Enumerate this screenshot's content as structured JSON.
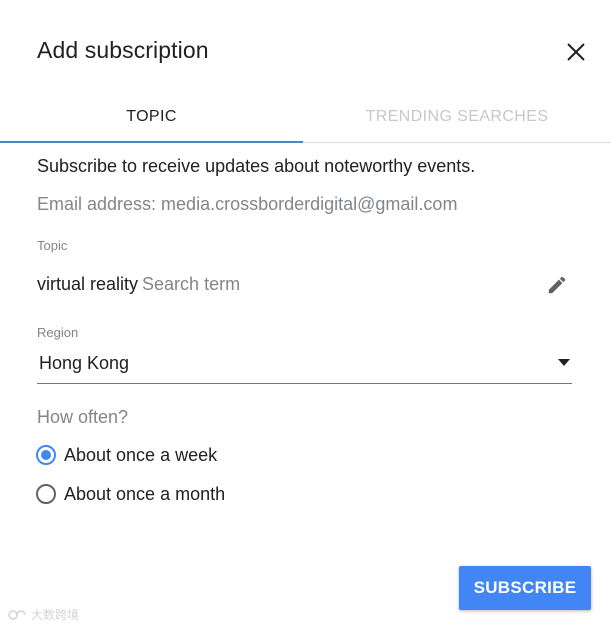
{
  "dialog": {
    "title": "Add subscription"
  },
  "tabs": [
    {
      "label": "TOPIC",
      "active": true
    },
    {
      "label": "TRENDING SEARCHES",
      "active": false
    }
  ],
  "description": "Subscribe to receive updates about noteworthy events.",
  "email": "Email address: media.crossborderdigital@gmail.com",
  "topic": {
    "label": "Topic",
    "value": "virtual reality",
    "placeholder": "Search term"
  },
  "region": {
    "label": "Region",
    "value": "Hong Kong"
  },
  "frequency": {
    "label": "How often?",
    "options": [
      {
        "label": "About once a week",
        "selected": true
      },
      {
        "label": "About once a month",
        "selected": false
      }
    ]
  },
  "subscribe_label": "SUBSCRIBE",
  "colors": {
    "accent": "#4285f4",
    "tab_indicator": "#4a86c7",
    "muted_text": "#80868b",
    "disabled_tab": "#c8c8c8"
  },
  "icons": {
    "close": "close-icon",
    "edit": "pencil-icon",
    "dropdown": "dropdown-arrow-icon"
  },
  "watermark": "大数跨境"
}
